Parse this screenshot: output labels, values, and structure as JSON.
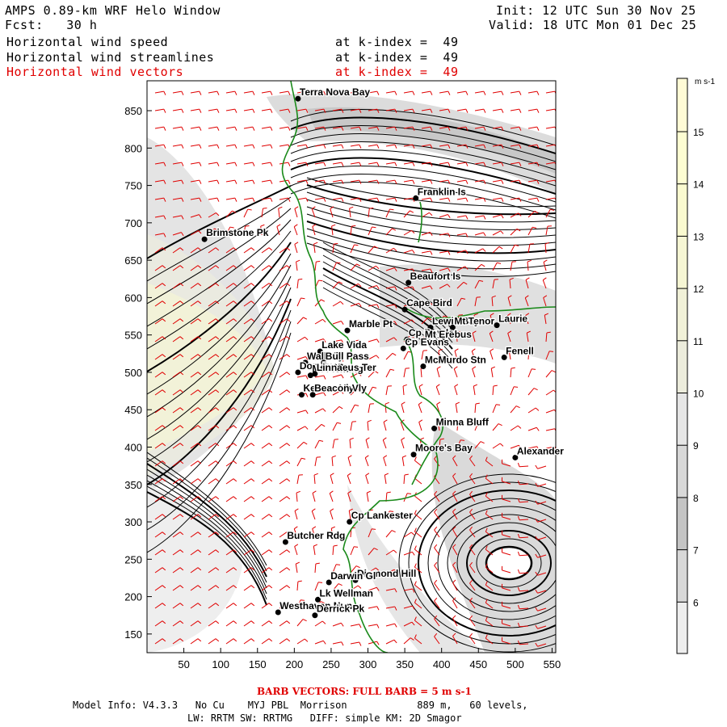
{
  "header": {
    "title": "AMPS 0.89-km WRF Helo Window",
    "forecast": "Fcst:   30 h",
    "init": "Init: 12 UTC Sun 30 Nov 25",
    "valid": "Valid: 18 UTC Mon 01 Dec 25",
    "fields": [
      {
        "name": "Horizontal wind speed",
        "level": "at k-index =  49",
        "color": "#000000"
      },
      {
        "name": "Horizontal wind streamlines",
        "level": "at k-index =  49",
        "color": "#000000"
      },
      {
        "name": "Horizontal wind vectors",
        "level": "at k-index =  49",
        "color": "#e00000"
      }
    ]
  },
  "colorbar": {
    "unit": "m s-1",
    "levels": [
      "15",
      "14",
      "13",
      "12",
      "11",
      "10",
      "9",
      "8",
      "7",
      "6"
    ],
    "colors": {
      "low": "#ffffff",
      "grey1": "#eeeeee",
      "grey2": "#d8d8d8",
      "grey3": "#c4c4c4",
      "band9": "#e6e6e6",
      "band11": "#ececdc",
      "band12": "#f1f1d8",
      "band13": "#f6f6d4",
      "band14": "#fafad0",
      "band15": "#fdfdd2"
    }
  },
  "axes": {
    "x_ticks": [
      "50",
      "100",
      "150",
      "200",
      "250",
      "300",
      "350",
      "400",
      "450",
      "500",
      "550"
    ],
    "y_ticks": [
      "850",
      "800",
      "750",
      "700",
      "650",
      "600",
      "550",
      "500",
      "450",
      "400",
      "350",
      "300",
      "250",
      "200",
      "150"
    ],
    "xlim": [
      0,
      555
    ],
    "ylim": [
      125,
      890
    ]
  },
  "places": [
    {
      "name": "Terra Nova Bay",
      "x": 205,
      "y": 866
    },
    {
      "name": "Franklin Is",
      "x": 365,
      "y": 733
    },
    {
      "name": "Brimstone Pk",
      "x": 78,
      "y": 678
    },
    {
      "name": "Beaufort Is",
      "x": 355,
      "y": 620
    },
    {
      "name": "Cape Bird",
      "x": 350,
      "y": 584
    },
    {
      "name": "Lewis Bay",
      "x": 385,
      "y": 560
    },
    {
      "name": "Mt Tenor",
      "x": 415,
      "y": 560
    },
    {
      "name": "Laurie",
      "x": 475,
      "y": 563
    },
    {
      "name": "Marble Pt",
      "x": 272,
      "y": 556
    },
    {
      "name": "Cp Royds",
      "x": 353,
      "y": 544
    },
    {
      "name": "Mt Erebus",
      "x": 375,
      "y": 542
    },
    {
      "name": "Cp Evans",
      "x": 348,
      "y": 532
    },
    {
      "name": "Lake Vida",
      "x": 235,
      "y": 528
    },
    {
      "name": "Fenell",
      "x": 485,
      "y": 520
    },
    {
      "name": "Wall Vly",
      "x": 215,
      "y": 513
    },
    {
      "name": "Bull Pass",
      "x": 240,
      "y": 513
    },
    {
      "name": "McMurdo Stn",
      "x": 375,
      "y": 508
    },
    {
      "name": "Don Juan",
      "x": 205,
      "y": 500
    },
    {
      "name": "Mt Fleming",
      "x": 222,
      "y": 496
    },
    {
      "name": "Linnaeus Ter",
      "x": 228,
      "y": 498
    },
    {
      "name": "Kennar Vly",
      "x": 210,
      "y": 470
    },
    {
      "name": "Beacon Vly",
      "x": 225,
      "y": 470
    },
    {
      "name": "Minna Bluff",
      "x": 390,
      "y": 425
    },
    {
      "name": "Moore's Bay",
      "x": 362,
      "y": 390
    },
    {
      "name": "Alexander",
      "x": 500,
      "y": 386
    },
    {
      "name": "Cp Lankester",
      "x": 275,
      "y": 300
    },
    {
      "name": "Butcher Rdg",
      "x": 188,
      "y": 273
    },
    {
      "name": "Diamond Hill",
      "x": 283,
      "y": 222
    },
    {
      "name": "Darwin Gl",
      "x": 247,
      "y": 219
    },
    {
      "name": "Lk Wellman",
      "x": 232,
      "y": 196
    },
    {
      "name": "Westhaven Nun",
      "x": 178,
      "y": 179
    },
    {
      "name": "Derrick Pk",
      "x": 228,
      "y": 175
    }
  ],
  "footer": {
    "barb_note": "BARB VECTORS:  FULL BARB = 5 m s-1",
    "model_info": "Model Info: V4.3.3   No Cu    MYJ PBL  Morrison            889 m,   60 levels,",
    "physics": "LW: RRTM SW: RRTMG   DIFF: simple KM: 2D Smagor"
  }
}
